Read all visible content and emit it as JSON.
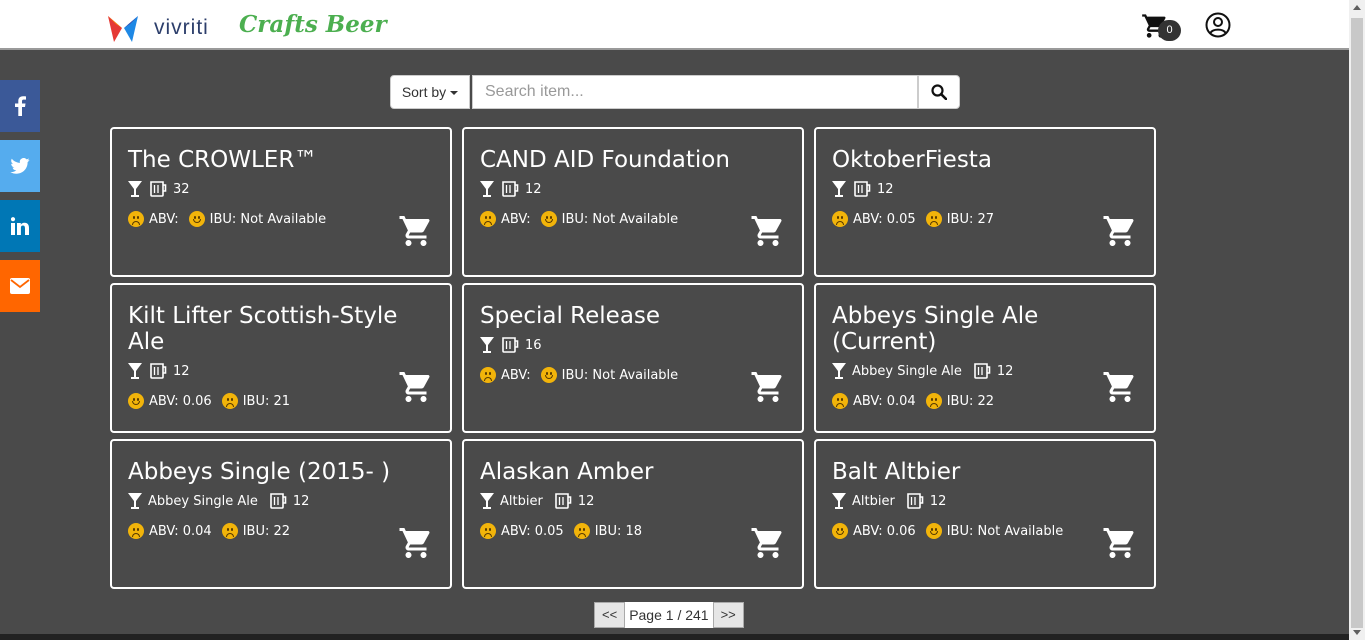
{
  "header": {
    "brand": "vivriti",
    "tagline": "Crafts Beer",
    "cart_count": "0"
  },
  "social": [
    "facebook",
    "twitter",
    "linkedin",
    "email"
  ],
  "toolbar": {
    "sort_label": "Sort by",
    "search_placeholder": "Search item..."
  },
  "products": [
    {
      "name": "The CROWLER™",
      "style": "",
      "ounces": "32",
      "abv": "ABV:",
      "ibu": "IBU: Not Available",
      "abv_face": "frown",
      "ibu_face": "smile"
    },
    {
      "name": "CAND AID Foundation",
      "style": "",
      "ounces": "12",
      "abv": "ABV:",
      "ibu": "IBU: Not Available",
      "abv_face": "frown",
      "ibu_face": "smile"
    },
    {
      "name": "OktoberFiesta",
      "style": "",
      "ounces": "12",
      "abv": "ABV: 0.05",
      "ibu": "IBU: 27",
      "abv_face": "frown",
      "ibu_face": "frown"
    },
    {
      "name": "Kilt Lifter Scottish-Style Ale",
      "style": "",
      "ounces": "12",
      "abv": "ABV: 0.06",
      "ibu": "IBU: 21",
      "abv_face": "smile",
      "ibu_face": "frown"
    },
    {
      "name": "Special Release",
      "style": "",
      "ounces": "16",
      "abv": "ABV:",
      "ibu": "IBU: Not Available",
      "abv_face": "frown",
      "ibu_face": "smile"
    },
    {
      "name": "Abbeys Single Ale (Current)",
      "style": "Abbey Single Ale",
      "ounces": "12",
      "abv": "ABV: 0.04",
      "ibu": "IBU: 22",
      "abv_face": "frown",
      "ibu_face": "frown"
    },
    {
      "name": "Abbeys Single (2015- )",
      "style": "Abbey Single Ale",
      "ounces": "12",
      "abv": "ABV: 0.04",
      "ibu": "IBU: 22",
      "abv_face": "frown",
      "ibu_face": "frown"
    },
    {
      "name": "Alaskan Amber",
      "style": "Altbier",
      "ounces": "12",
      "abv": "ABV: 0.05",
      "ibu": "IBU: 18",
      "abv_face": "frown",
      "ibu_face": "frown"
    },
    {
      "name": "Balt Altbier",
      "style": "Altbier",
      "ounces": "12",
      "abv": "ABV: 0.06",
      "ibu": "IBU: Not Available",
      "abv_face": "smile",
      "ibu_face": "smile"
    }
  ],
  "pagination": {
    "prev": "<<",
    "text": "Page 1 / 241",
    "next": ">>"
  },
  "colors": {
    "background": "#4a4a4a",
    "tagline": "#4caf50",
    "facebook": "#3b5998",
    "twitter": "#55acee",
    "linkedin": "#0077b5",
    "email": "#ff6600",
    "emoji": "#f2b40a"
  }
}
